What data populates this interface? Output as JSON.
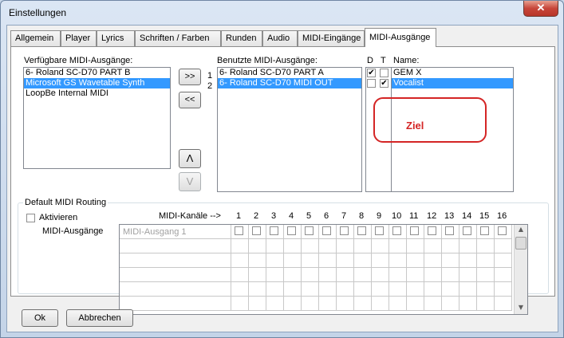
{
  "window": {
    "title": "Einstellungen",
    "close_glyph": "✕"
  },
  "tabs": [
    "Allgemein",
    "Player",
    "Lyrics",
    "Schriften / Farben",
    "Runden",
    "Audio",
    "MIDI-Eingänge",
    "MIDI-Ausgänge"
  ],
  "available": {
    "label": "Verfügbare MIDI-Ausgänge:",
    "items": [
      {
        "text": "6- Roland SC-D70 PART B",
        "selected": false
      },
      {
        "text": "Microsoft GS Wavetable Synth",
        "selected": true
      },
      {
        "text": "LoopBe Internal MIDI",
        "selected": false
      }
    ]
  },
  "move_buttons": {
    "add": ">>",
    "remove": "<<",
    "up": "Λ",
    "down": "V"
  },
  "used": {
    "label": "Benutzte MIDI-Ausgänge:",
    "col_d": "D",
    "col_t": "T",
    "col_name": "Name:",
    "items": [
      {
        "num": "1",
        "text": "6- Roland SC-D70 PART A",
        "selected": false,
        "d": true,
        "t": false,
        "name": "GEM X"
      },
      {
        "num": "2",
        "text": "6- Roland SC-D70 MIDI OUT",
        "selected": true,
        "d": false,
        "t": true,
        "name": "Vocalist"
      }
    ]
  },
  "annotation": {
    "text": "Ziel",
    "color": "#d42525"
  },
  "routing": {
    "title": "Default MIDI Routing",
    "activate_label": "Aktivieren",
    "channels_label": "MIDI-Kanäle  -->",
    "outputs_label": "MIDI-Ausgänge",
    "channels": [
      "1",
      "2",
      "3",
      "4",
      "5",
      "6",
      "7",
      "8",
      "9",
      "10",
      "11",
      "12",
      "13",
      "14",
      "15",
      "16"
    ],
    "first_row_value": "MIDI-Ausgang 1"
  },
  "footer": {
    "ok": "Ok",
    "cancel": "Abbrechen"
  },
  "colors": {
    "selection": "#3399ff",
    "accent_red": "#d42525"
  }
}
